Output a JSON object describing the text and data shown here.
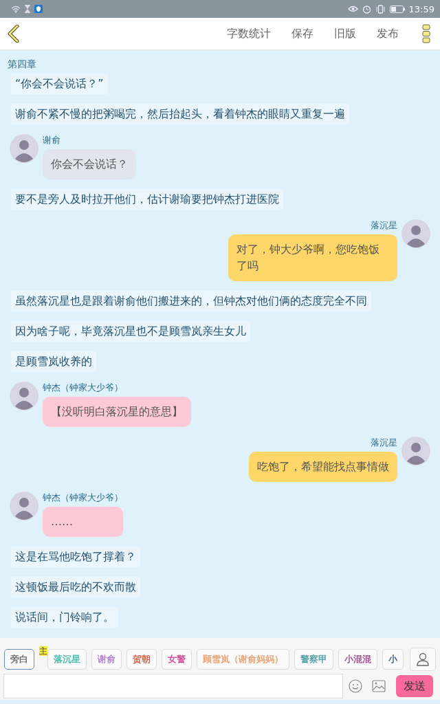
{
  "status_bar": {
    "time": "13:59"
  },
  "toolbar": {
    "actions": [
      "字数统计",
      "保存",
      "旧版",
      "发布"
    ]
  },
  "chapter": "第四章",
  "items": [
    {
      "kind": "narration",
      "text": "“你会不会说话？”"
    },
    {
      "kind": "narration",
      "text": "谢俞不紧不慢的把粥喝完，然后抬起头，看着钟杰的眼睛又重复一遍"
    },
    {
      "kind": "left",
      "speaker": "谢俞",
      "text": "你会不会说话？",
      "color": "#e1e6ee"
    },
    {
      "kind": "narration",
      "text": "要不是旁人及时拉开他们，估计谢瑜要把钟杰打进医院"
    },
    {
      "kind": "right",
      "speaker": "落沉星",
      "text": "对了，钟大少爷啊，您吃饱饭了吗",
      "color": "#fcd668"
    },
    {
      "kind": "narration",
      "text": "虽然落沉星也是跟着谢俞他们搬进来的，但钟杰对他们俩的态度完全不同"
    },
    {
      "kind": "narration",
      "text": "因为啥子呢，毕竟落沉星也不是顾雪岚亲生女儿"
    },
    {
      "kind": "narration",
      "text": "是顾雪岚收养的"
    },
    {
      "kind": "left",
      "speaker": "钟杰（钟家大少爷）",
      "text": "【没听明白落沉星的意思】",
      "color": "#fdc9d6"
    },
    {
      "kind": "right",
      "speaker": "落沉星",
      "text": "吃饱了，希望能找点事情做",
      "color": "#fcd668"
    },
    {
      "kind": "left",
      "speaker": "钟杰（钟家大少爷）",
      "text": "……",
      "color": "#fdc9d6"
    },
    {
      "kind": "narration",
      "text": "这是在骂他吃饱了撑着？"
    },
    {
      "kind": "narration",
      "text": "这顿饭最后吃的不欢而散"
    },
    {
      "kind": "narration",
      "text": "说话间，门铃响了。"
    }
  ],
  "characters": [
    {
      "name": "旁白",
      "color": "#666666",
      "selected": true
    },
    {
      "name": "落沉星",
      "color": "#3cb8a8",
      "selected": false,
      "badge": "主"
    },
    {
      "name": "谢俞",
      "color": "#b07ad0",
      "selected": false
    },
    {
      "name": "贺朝",
      "color": "#d0583c",
      "selected": false
    },
    {
      "name": "女警",
      "color": "#d04a9a",
      "selected": false
    },
    {
      "name": "顾雪岚（谢俞妈妈）",
      "color": "#e8a070",
      "selected": false
    },
    {
      "name": "警察甲",
      "color": "#4aa0a8",
      "selected": false
    },
    {
      "name": "小混混",
      "color": "#a04890",
      "selected": false
    },
    {
      "name": "小",
      "color": "#3a5a7a",
      "selected": false
    }
  ],
  "send_button": "发送"
}
